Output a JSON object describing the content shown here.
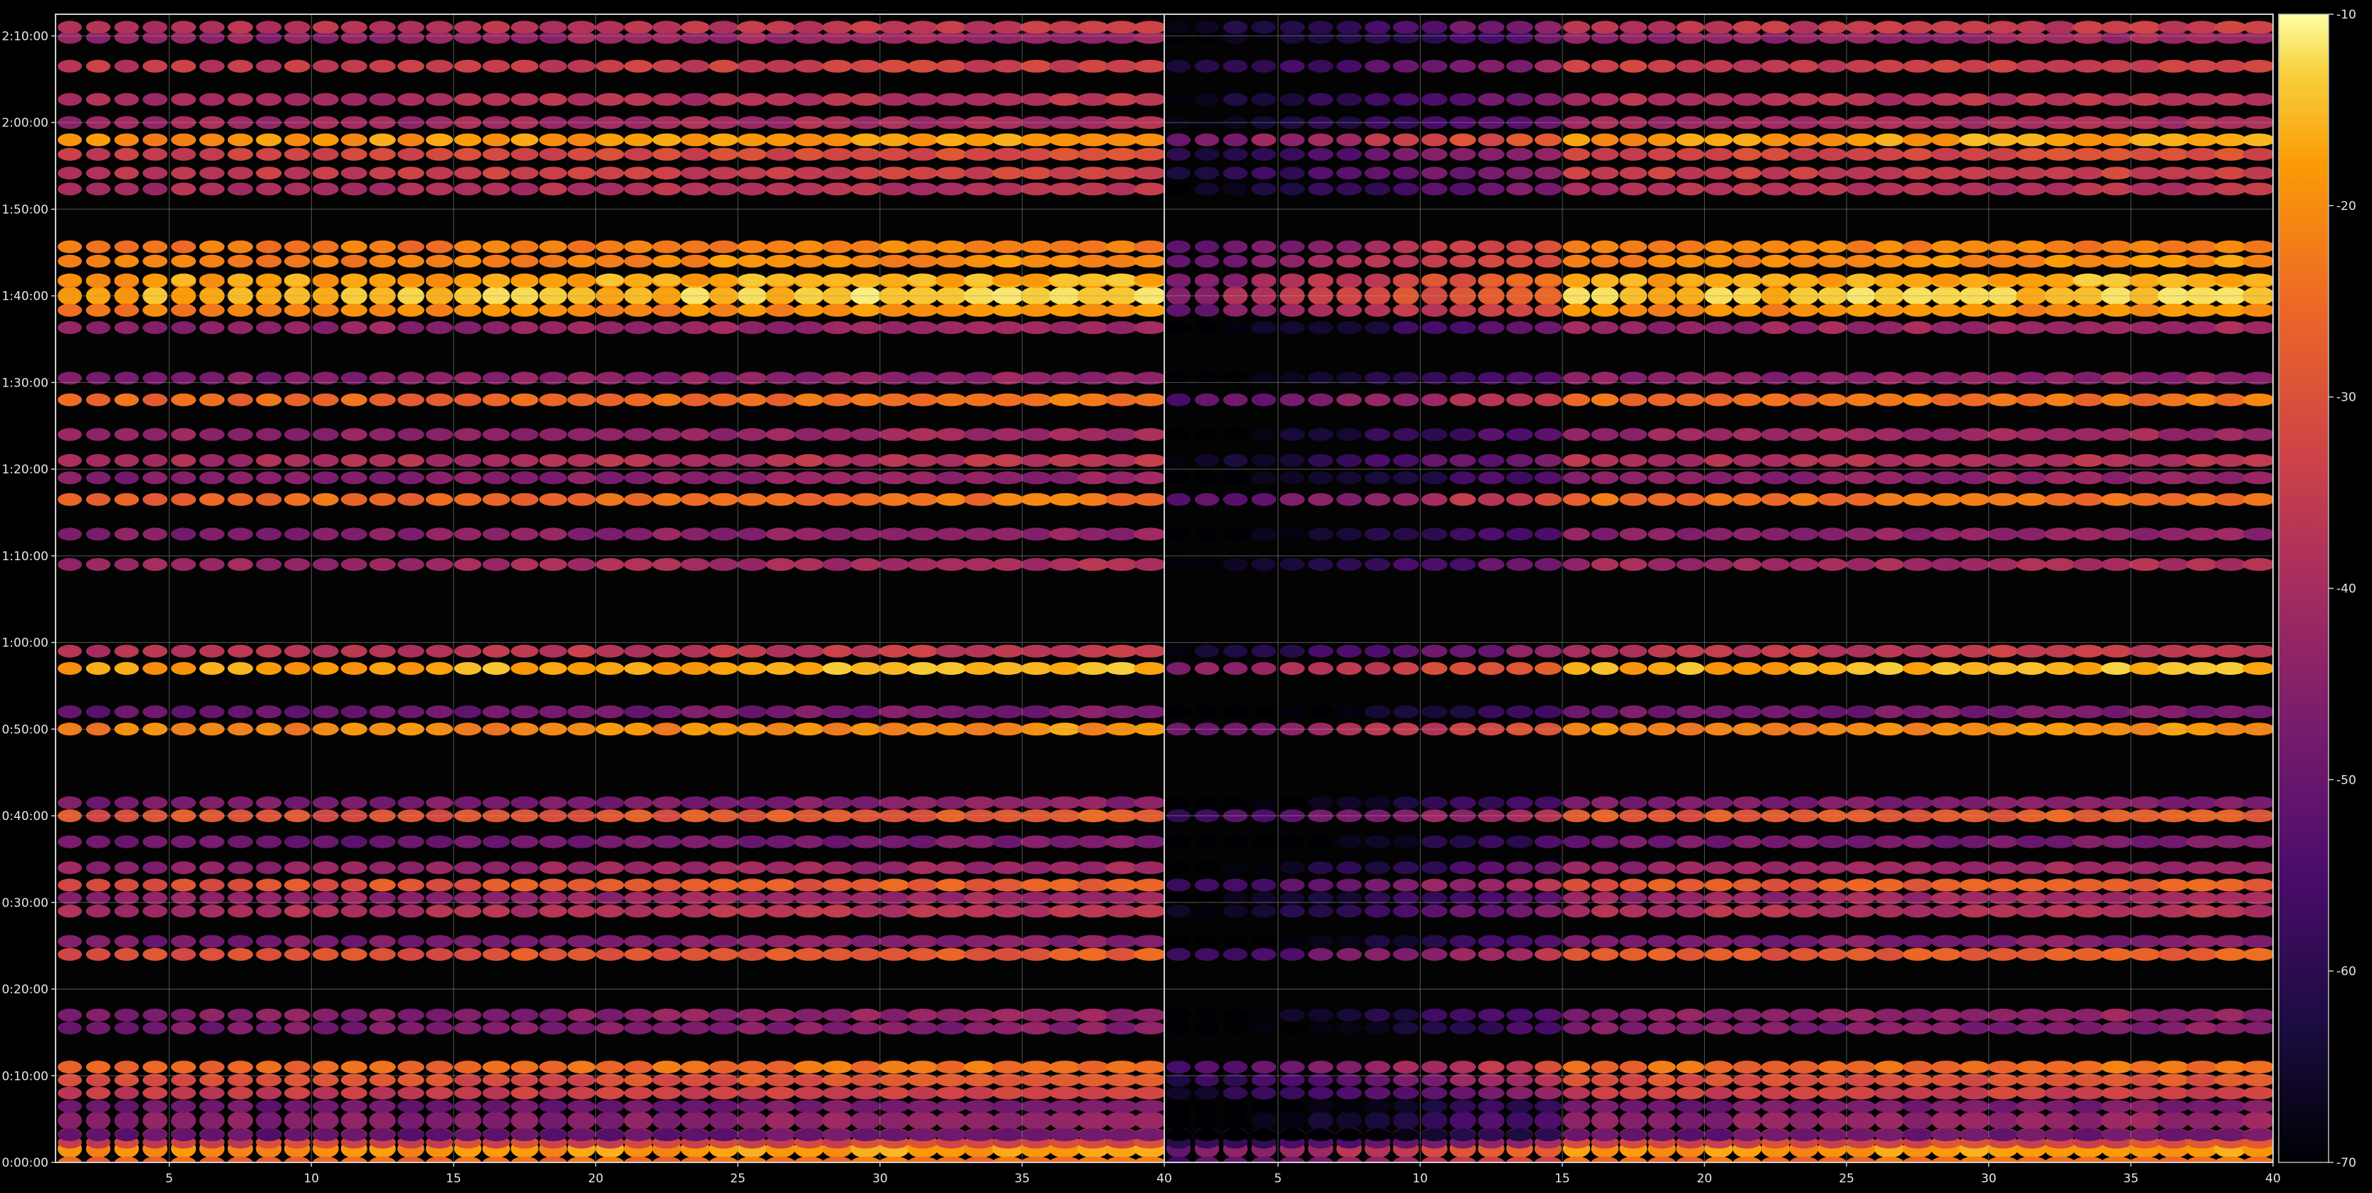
{
  "chart_data": {
    "type": "heatmap",
    "title": "",
    "panels": [
      {
        "name": "",
        "x_range": [
          1,
          40
        ],
        "y_range_seconds": [
          0,
          7950
        ]
      },
      {
        "name": "",
        "x_range": [
          1,
          40
        ],
        "y_range_seconds": [
          0,
          7950
        ]
      }
    ],
    "x_ticks": [
      "5",
      "10",
      "15",
      "20",
      "25",
      "30",
      "35",
      "40"
    ],
    "y_ticks": [
      "0:00:00",
      "0:10:00",
      "0:20:00",
      "0:30:00",
      "0:40:00",
      "0:50:00",
      "1:00:00",
      "1:10:00",
      "1:20:00",
      "1:30:00",
      "1:40:00",
      "1:50:00",
      "2:00:00",
      "2:10:00"
    ],
    "colorbar": {
      "min": -70,
      "max": -10,
      "ticks": [
        "-10",
        "-20",
        "-30",
        "-40",
        "-50",
        "-60",
        "-70"
      ],
      "colormap": "inferno"
    },
    "grid": true,
    "columns_per_panel": 39,
    "row_bands": [
      {
        "time_s": 95,
        "level": -20,
        "dense": true
      },
      {
        "time_s": 140,
        "level": -34
      },
      {
        "time_s": 290,
        "level": -46,
        "dense": true
      },
      {
        "time_s": 480,
        "level": -36
      },
      {
        "time_s": 570,
        "level": -32
      },
      {
        "time_s": 660,
        "level": -26
      },
      {
        "time_s": 930,
        "level": -48
      },
      {
        "time_s": 1020,
        "level": -46
      },
      {
        "time_s": 1440,
        "level": -30
      },
      {
        "time_s": 1530,
        "level": -48
      },
      {
        "time_s": 1740,
        "level": -40
      },
      {
        "time_s": 1830,
        "level": -44
      },
      {
        "time_s": 1920,
        "level": -30
      },
      {
        "time_s": 2040,
        "level": -44
      },
      {
        "time_s": 2220,
        "level": -50
      },
      {
        "time_s": 2400,
        "level": -30
      },
      {
        "time_s": 2490,
        "level": -48
      },
      {
        "time_s": 3000,
        "level": -22
      },
      {
        "time_s": 3120,
        "level": -50
      },
      {
        "time_s": 3420,
        "level": -18
      },
      {
        "time_s": 3540,
        "level": -38
      },
      {
        "time_s": 4140,
        "level": -42
      },
      {
        "time_s": 4350,
        "level": -46
      },
      {
        "time_s": 4590,
        "level": -26
      },
      {
        "time_s": 4740,
        "level": -46
      },
      {
        "time_s": 4860,
        "level": -40
      },
      {
        "time_s": 5040,
        "level": -44
      },
      {
        "time_s": 5280,
        "level": -26
      },
      {
        "time_s": 5430,
        "level": -46
      },
      {
        "time_s": 5780,
        "level": -44
      },
      {
        "time_s": 5900,
        "level": -20
      },
      {
        "time_s": 6000,
        "level": -16,
        "dense": true
      },
      {
        "time_s": 6110,
        "level": -18
      },
      {
        "time_s": 6240,
        "level": -22
      },
      {
        "time_s": 6340,
        "level": -24
      },
      {
        "time_s": 6740,
        "level": -40
      },
      {
        "time_s": 6850,
        "level": -36
      },
      {
        "time_s": 6980,
        "level": -34
      },
      {
        "time_s": 7080,
        "level": -20
      },
      {
        "time_s": 7200,
        "level": -42
      },
      {
        "time_s": 7360,
        "level": -40
      },
      {
        "time_s": 7590,
        "level": -36
      },
      {
        "time_s": 7790,
        "level": -44
      },
      {
        "time_s": 7860,
        "level": -38
      }
    ]
  }
}
